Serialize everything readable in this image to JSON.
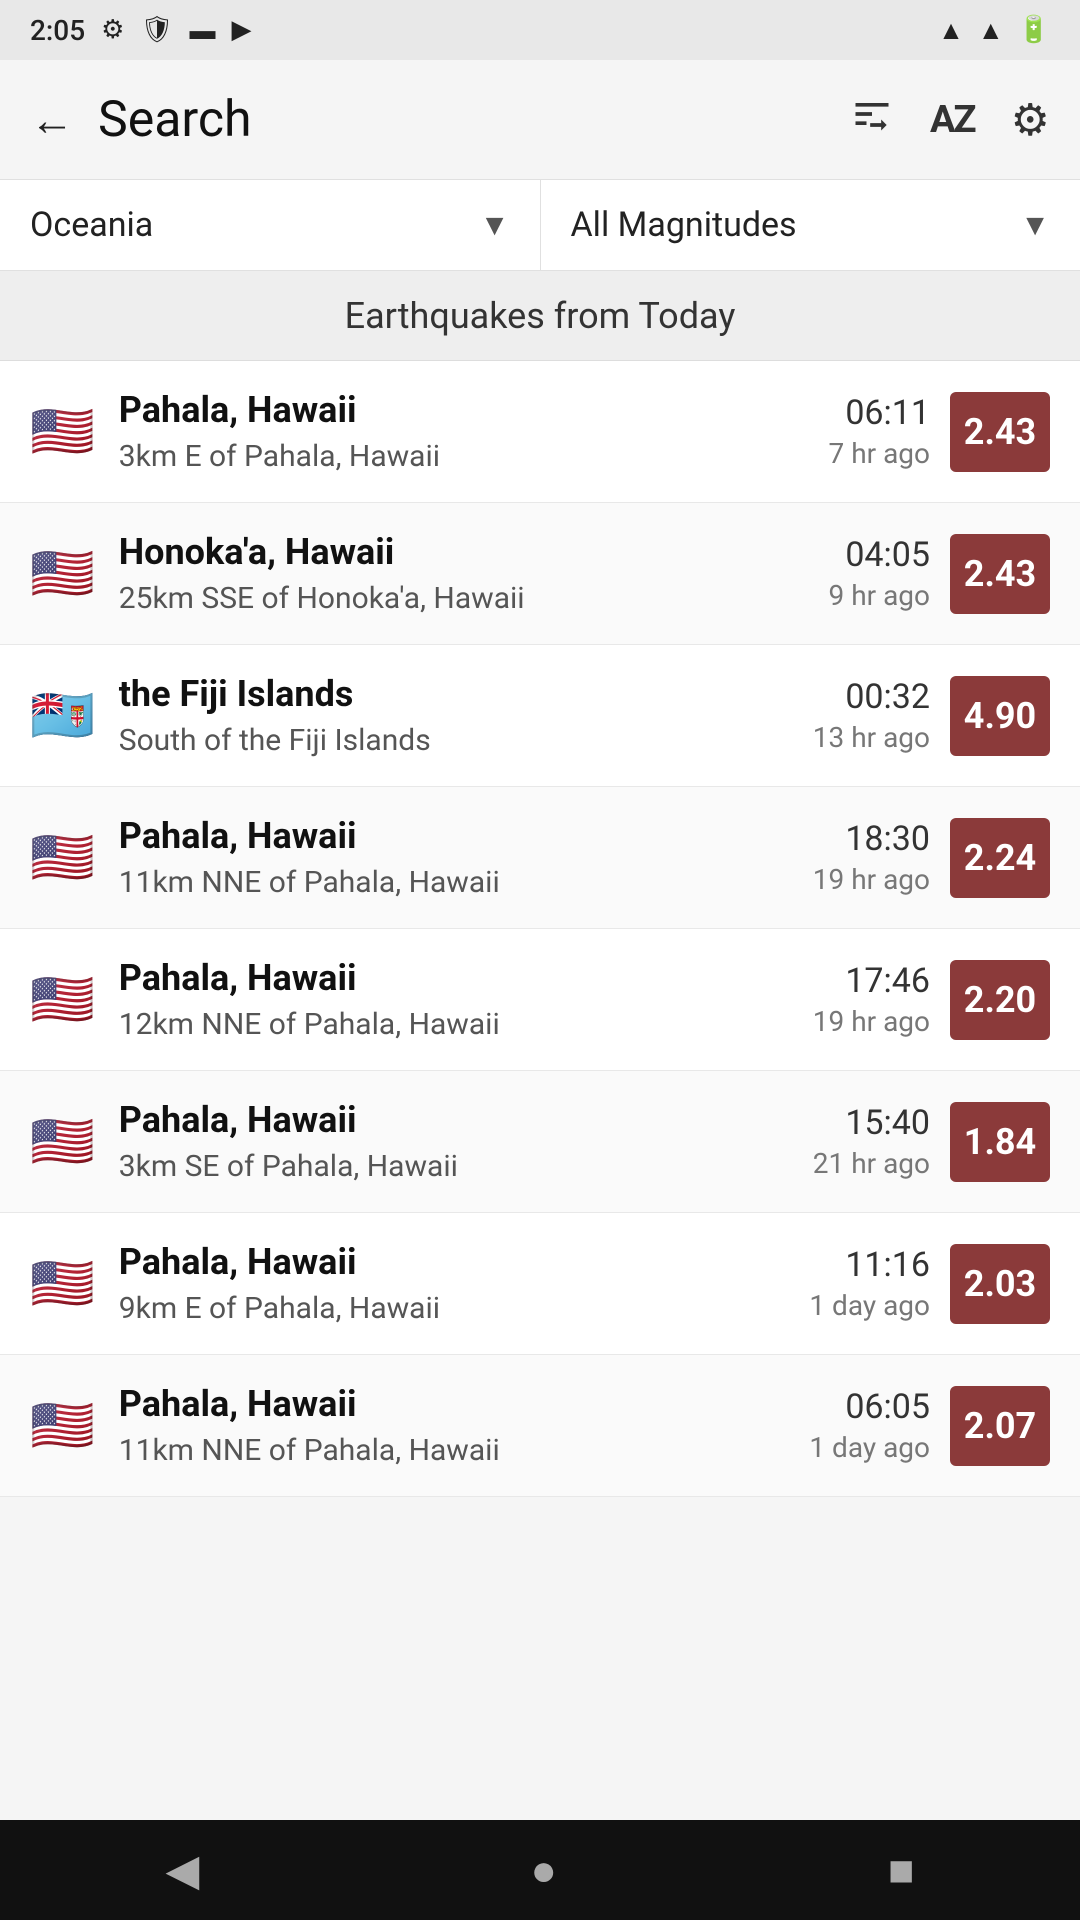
{
  "statusBar": {
    "time": "2:05",
    "icons": [
      "settings",
      "shield",
      "sd-card",
      "play-store",
      "wifi",
      "signal",
      "battery"
    ]
  },
  "appBar": {
    "title": "Search",
    "icons": {
      "sort": "sort-icon",
      "az": "AZ",
      "settings": "settings-icon"
    }
  },
  "filters": {
    "region": "Oceania",
    "magnitude": "All Magnitudes"
  },
  "sectionHeader": "Earthquakes from Today",
  "earthquakes": [
    {
      "flag": "🇺🇸",
      "location": "Pahala, Hawaii",
      "description": "3km E of Pahala, Hawaii",
      "time": "06:11",
      "ago": "7 hr ago",
      "magnitude": "2.43"
    },
    {
      "flag": "🇺🇸",
      "location": "Honoka'a, Hawaii",
      "description": "25km SSE of Honoka'a, Hawaii",
      "time": "04:05",
      "ago": "9 hr ago",
      "magnitude": "2.43"
    },
    {
      "flag": "🇫🇯",
      "location": "the Fiji Islands",
      "description": "South of the Fiji Islands",
      "time": "00:32",
      "ago": "13 hr ago",
      "magnitude": "4.90"
    },
    {
      "flag": "🇺🇸",
      "location": "Pahala, Hawaii",
      "description": "11km NNE of Pahala, Hawaii",
      "time": "18:30",
      "ago": "19 hr ago",
      "magnitude": "2.24"
    },
    {
      "flag": "🇺🇸",
      "location": "Pahala, Hawaii",
      "description": "12km NNE of Pahala, Hawaii",
      "time": "17:46",
      "ago": "19 hr ago",
      "magnitude": "2.20"
    },
    {
      "flag": "🇺🇸",
      "location": "Pahala, Hawaii",
      "description": "3km SE of Pahala, Hawaii",
      "time": "15:40",
      "ago": "21 hr ago",
      "magnitude": "1.84"
    },
    {
      "flag": "🇺🇸",
      "location": "Pahala, Hawaii",
      "description": "9km E of Pahala, Hawaii",
      "time": "11:16",
      "ago": "1 day ago",
      "magnitude": "2.03"
    },
    {
      "flag": "🇺🇸",
      "location": "Pahala, Hawaii",
      "description": "11km NNE of Pahala, Hawaii",
      "time": "06:05",
      "ago": "1 day ago",
      "magnitude": "2.07"
    }
  ],
  "navBar": {
    "back": "◀",
    "home": "●",
    "recent": "■"
  }
}
